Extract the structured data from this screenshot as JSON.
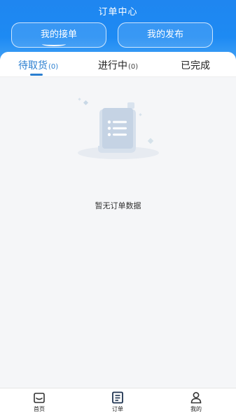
{
  "header": {
    "title": "订单中心",
    "segments": [
      {
        "label": "我的接单",
        "active": true
      },
      {
        "label": "我的发布",
        "active": false
      }
    ]
  },
  "tabs": [
    {
      "label": "待取货",
      "count": "(0)",
      "active": true
    },
    {
      "label": "进行中",
      "count": "(0)",
      "active": false
    },
    {
      "label": "已完成",
      "count": "",
      "active": false
    }
  ],
  "empty_state": {
    "icon": "empty-document-icon",
    "text": "暂无订单数据"
  },
  "tabbar": {
    "items": [
      {
        "label": "首页",
        "icon": "home-icon"
      },
      {
        "label": "订单",
        "icon": "order-list-icon",
        "active": true
      },
      {
        "label": "我的",
        "icon": "user-icon"
      }
    ]
  },
  "colors": {
    "header_blue": "#1f86f0",
    "active_tab": "#2b7fd0"
  }
}
